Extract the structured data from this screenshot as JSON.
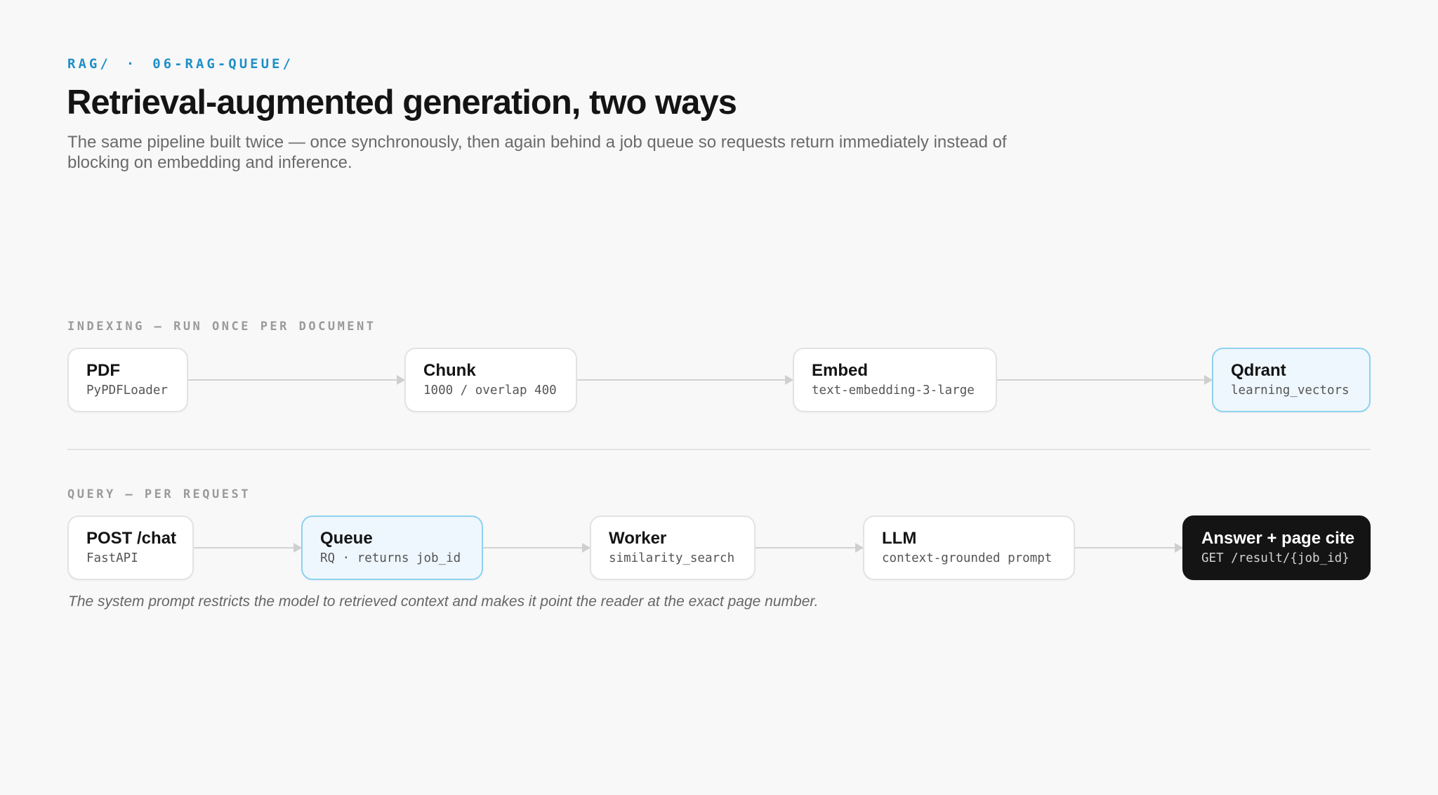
{
  "header": {
    "breadcrumb": [
      "RAG/",
      "·",
      "06-RAG-QUEUE/"
    ],
    "title": "Retrieval-augmented generation, two ways",
    "subtitle": "The same pipeline built twice — once synchronously, then again behind a job queue so requests return immediately instead of blocking on embedding and inference."
  },
  "indexing": {
    "label": "INDEXING — RUN ONCE PER DOCUMENT",
    "nodes": [
      {
        "name": "PDF",
        "sub": "PyPDFLoader"
      },
      {
        "name": "Chunk",
        "sub": "1000 / overlap 400"
      },
      {
        "name": "Embed",
        "sub": "text-embedding-3-large"
      },
      {
        "name": "Qdrant",
        "sub": "learning_vectors"
      }
    ]
  },
  "query": {
    "label": "QUERY — PER REQUEST",
    "nodes": [
      {
        "name": "POST /chat",
        "sub": "FastAPI"
      },
      {
        "name": "Queue",
        "sub": "RQ · returns job_id"
      },
      {
        "name": "Worker",
        "sub": "similarity_search"
      },
      {
        "name": "LLM",
        "sub": "context-grounded prompt"
      },
      {
        "name": "Answer + page cite",
        "sub": "GET /result/{job_id}"
      }
    ],
    "caption": "The system prompt restricts the model to retrieved context and makes it point the reader at the exact page number."
  },
  "colors": {
    "accent": "#1f8fc8",
    "accent_node_bg": "#eef7fd",
    "accent_node_border": "#8fd2ef",
    "dark_node_bg": "#141414"
  }
}
